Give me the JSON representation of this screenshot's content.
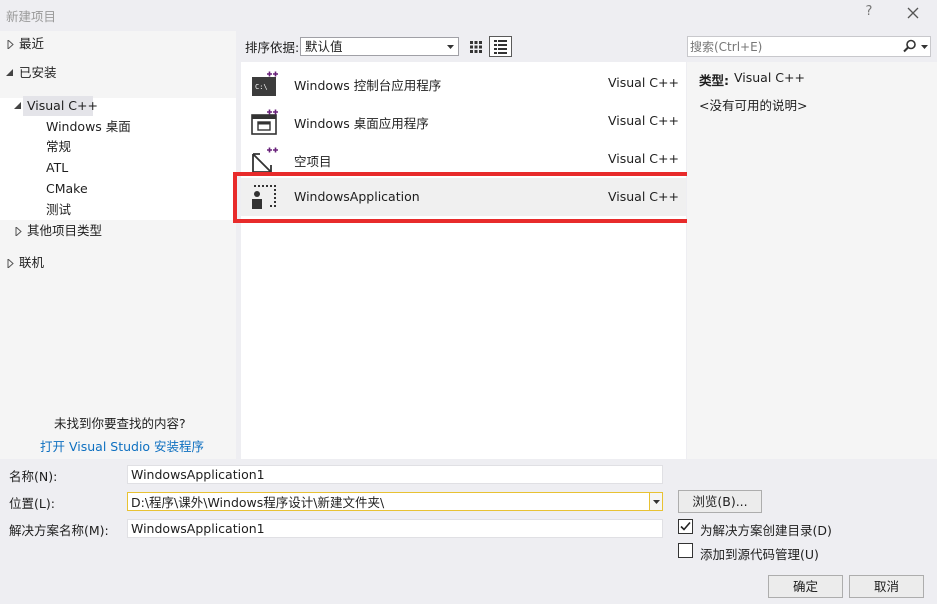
{
  "window": {
    "title": "新建项目",
    "help_glyph": "?"
  },
  "sidebar": {
    "recent": "最近",
    "installed": "已安装",
    "visual_cpp": "Visual C++",
    "children": [
      "Windows 桌面",
      "常规",
      "ATL",
      "CMake",
      "测试"
    ],
    "other_types": "其他项目类型",
    "online": "联机",
    "not_found": "未找到你要查找的内容?",
    "open_installer": "打开 Visual Studio 安装程序"
  },
  "toolbar": {
    "sort_label": "排序依据:",
    "sort_value": "默认值"
  },
  "templates": [
    {
      "name": "Windows 控制台应用程序",
      "lang": "Visual C++",
      "icon": "console-app-icon"
    },
    {
      "name": "Windows 桌面应用程序",
      "lang": "Visual C++",
      "icon": "desktop-app-icon"
    },
    {
      "name": "空项目",
      "lang": "Visual C++",
      "icon": "empty-project-icon"
    },
    {
      "name": "WindowsApplication",
      "lang": "Visual C++",
      "icon": "windows-application-icon",
      "selected": true
    }
  ],
  "details": {
    "search_placeholder": "搜索(Ctrl+E)",
    "type_label": "类型:",
    "type_value": "Visual C++",
    "description": "<没有可用的说明>"
  },
  "form": {
    "name_label": "名称(N):",
    "name_value": "WindowsApplication1",
    "location_label": "位置(L):",
    "location_value": "D:\\程序\\课外\\Windows程序设计\\新建文件夹\\",
    "solution_label": "解决方案名称(M):",
    "solution_value": "WindowsApplication1",
    "browse": "浏览(B)...",
    "create_dir_label": "为解决方案创建目录(D)",
    "create_dir_checked": true,
    "source_control_label": "添加到源代码管理(U)",
    "source_control_checked": false,
    "ok": "确定",
    "cancel": "取消"
  },
  "colors": {
    "accent": "#0e70c0",
    "highlight_frame": "#e82b2b",
    "template_accent": "#68217a"
  }
}
